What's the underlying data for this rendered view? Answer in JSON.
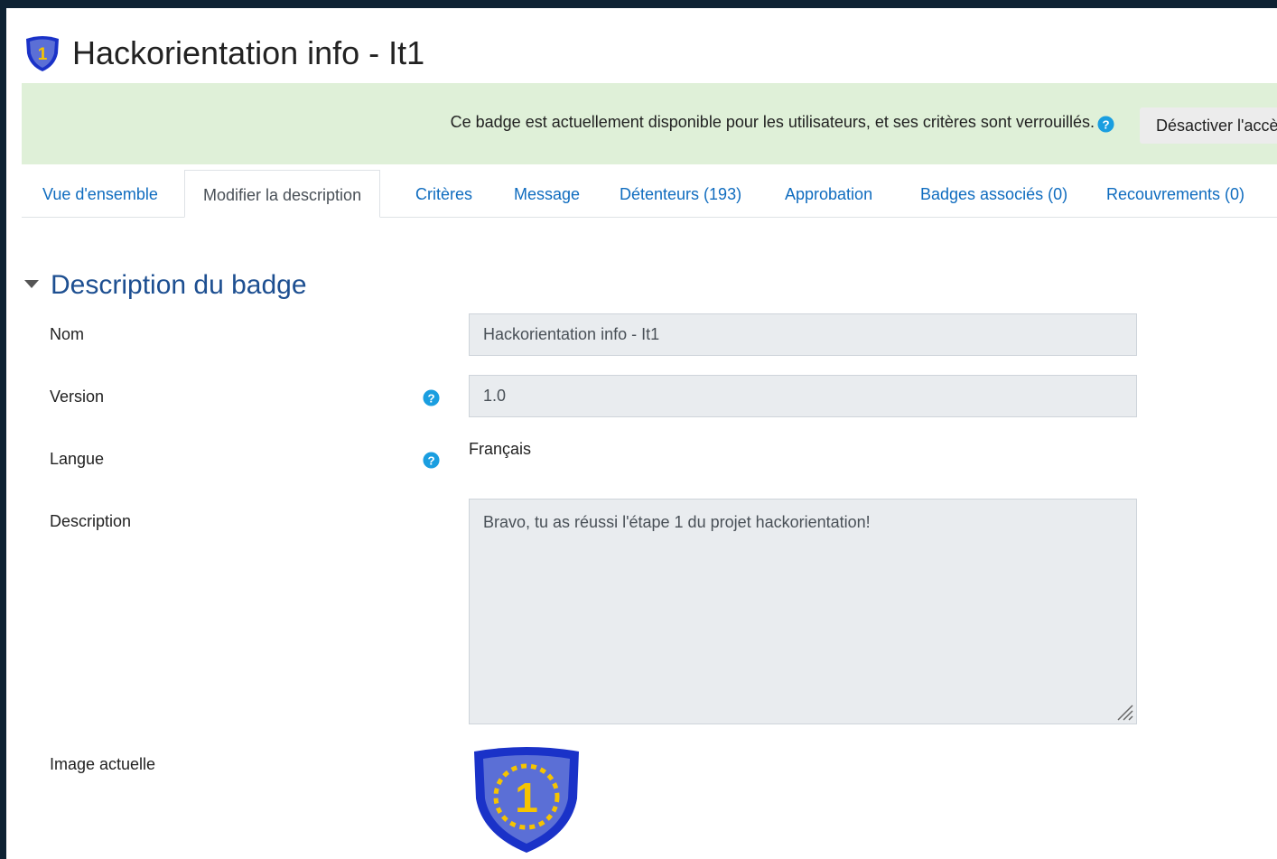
{
  "header": {
    "title": "Hackorientation info - It1",
    "badge_digit": "1"
  },
  "notice": {
    "text": "Ce badge est actuellement disponible pour les utilisateurs, et ses critères sont verrouillés.",
    "button_label": "Désactiver l'accès",
    "background_color": "#dff0d8"
  },
  "tabs": [
    {
      "label": "Vue d'ensemble",
      "active": false
    },
    {
      "label": "Modifier la description",
      "active": true
    },
    {
      "label": "Critères",
      "active": false
    },
    {
      "label": "Message",
      "active": false
    },
    {
      "label": "Détenteurs (193)",
      "active": false
    },
    {
      "label": "Approbation",
      "active": false
    },
    {
      "label": "Badges associés (0)",
      "active": false
    },
    {
      "label": "Recouvrements (0)",
      "active": false
    }
  ],
  "section": {
    "title": "Description du badge"
  },
  "form": {
    "name": {
      "label": "Nom",
      "value": "Hackorientation info - It1"
    },
    "version": {
      "label": "Version",
      "value": "1.0"
    },
    "language": {
      "label": "Langue",
      "value": "Français"
    },
    "description": {
      "label": "Description",
      "value": "Bravo, tu as réussi l'étape 1 du projet hackorientation!"
    },
    "image": {
      "label": "Image actuelle",
      "digit": "1"
    }
  },
  "colors": {
    "link": "#0f6cbf",
    "section_title": "#1d4f91",
    "help_icon": "#1a9ee0",
    "badge_shield_outer": "#1a32c8",
    "badge_shield_inner": "#5b6fd6",
    "badge_digit": "#f6c400"
  },
  "icons": [
    "badge-shield-icon",
    "help-icon",
    "chevron-down-icon",
    "resize-handle-icon"
  ]
}
